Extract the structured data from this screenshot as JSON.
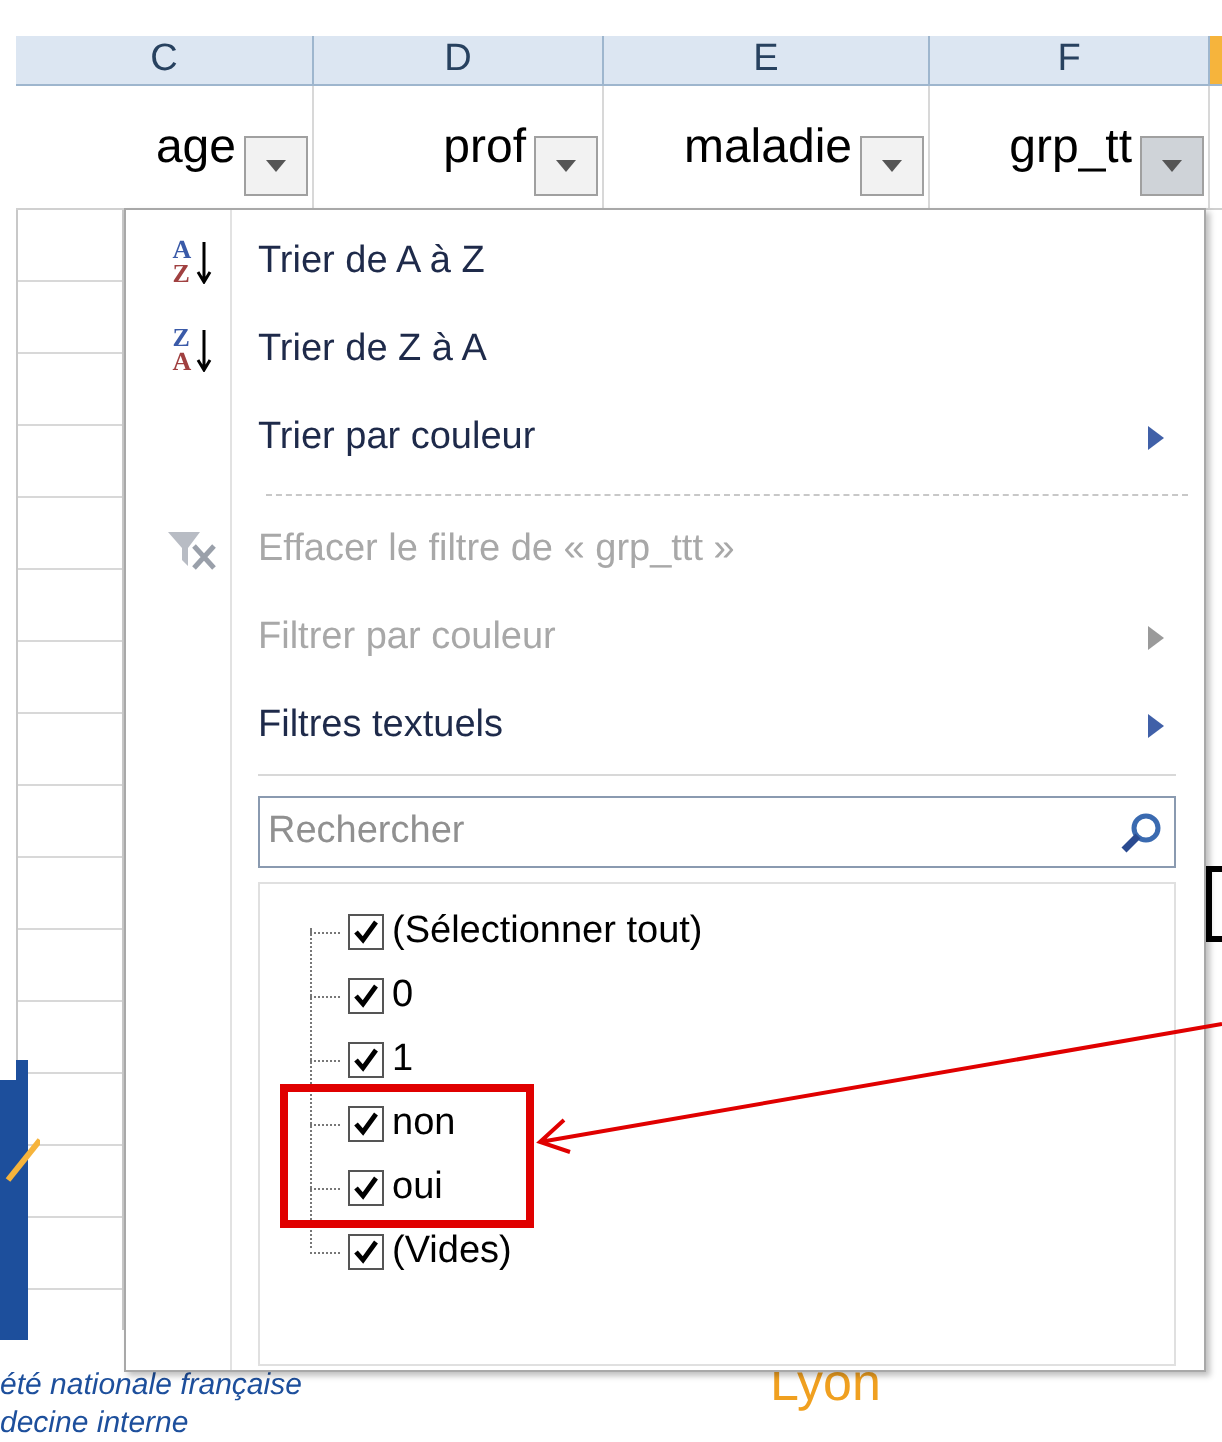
{
  "columns": [
    {
      "letter": "C",
      "header": "age"
    },
    {
      "letter": "D",
      "header": "prof"
    },
    {
      "letter": "E",
      "header": "maladie"
    },
    {
      "letter": "F",
      "header": "grp_tt"
    }
  ],
  "filter_menu": {
    "items": [
      {
        "kind": "sort",
        "icon_text": [
          "A",
          "Z"
        ],
        "label": "Trier de A à Z",
        "disabled": false
      },
      {
        "kind": "sort",
        "icon_text": [
          "Z",
          "A"
        ],
        "label": "Trier de Z à A",
        "disabled": false
      },
      {
        "kind": "submenu",
        "label": "Trier par couleur",
        "disabled": false
      },
      {
        "kind": "separator"
      },
      {
        "kind": "clear-filter",
        "label": "Effacer le filtre de « grp_ttt »",
        "disabled": true
      },
      {
        "kind": "submenu",
        "label": "Filtrer par couleur",
        "disabled": true
      },
      {
        "kind": "submenu",
        "label": "Filtres textuels",
        "disabled": false
      }
    ],
    "search": {
      "placeholder": "Rechercher"
    },
    "values": [
      {
        "label": "(Sélectionner tout)",
        "checked": true,
        "highlighted": false
      },
      {
        "label": "0",
        "checked": true,
        "highlighted": false
      },
      {
        "label": "1",
        "checked": true,
        "highlighted": false
      },
      {
        "label": "non",
        "checked": true,
        "highlighted": true
      },
      {
        "label": "oui",
        "checked": true,
        "highlighted": true
      },
      {
        "label": "(Vides)",
        "checked": true,
        "highlighted": false
      }
    ]
  },
  "footer": {
    "society_lines": [
      "été nationale française",
      "decine interne"
    ],
    "city": "Lyon"
  }
}
